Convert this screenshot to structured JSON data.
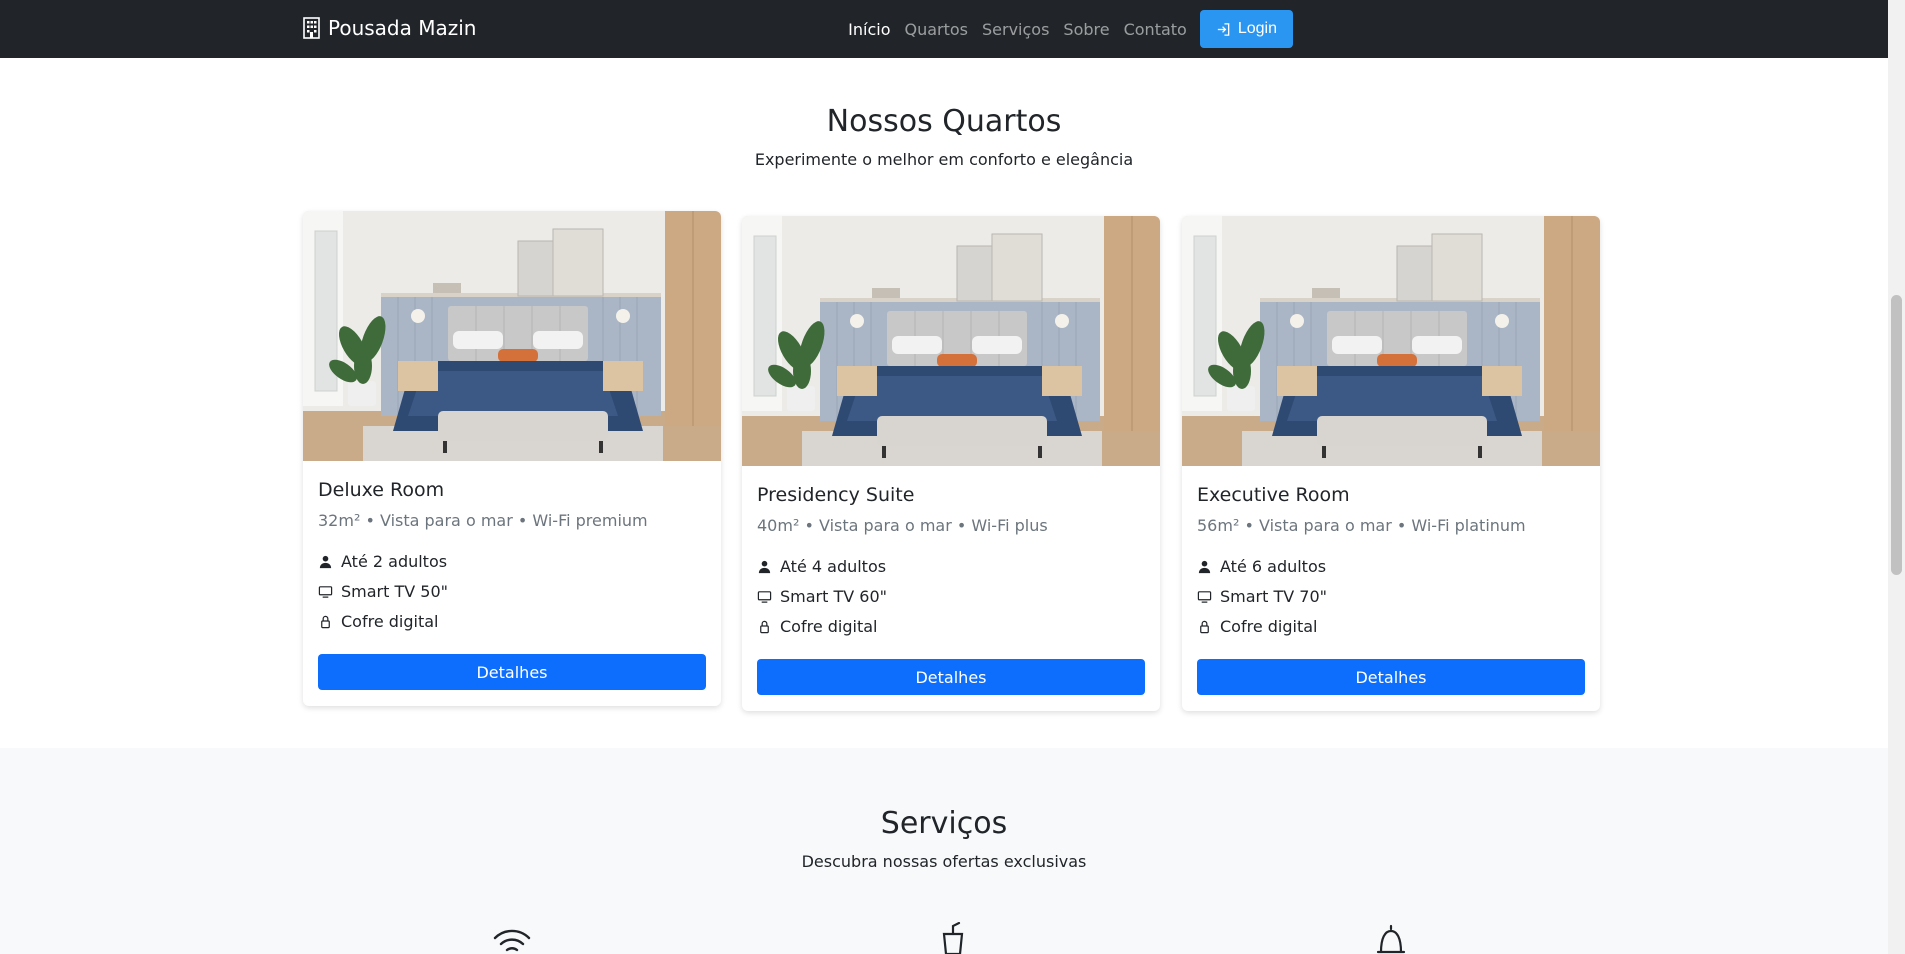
{
  "navbar": {
    "brand": "Pousada Mazin",
    "links": [
      "Início",
      "Quartos",
      "Serviços",
      "Sobre",
      "Contato"
    ],
    "login": "Login"
  },
  "rooms": {
    "title": "Nossos Quartos",
    "subtitle": "Experimente o melhor em conforto e elegância",
    "cards": [
      {
        "name": "Deluxe Room",
        "meta": "32m² • Vista para o mar • Wi-Fi premium",
        "guests": "Até 2 adultos",
        "tv": "Smart TV 50\"",
        "safe": "Cofre digital",
        "button": "Detalhes"
      },
      {
        "name": "Presidency Suite",
        "meta": "40m² • Vista para o mar • Wi-Fi plus",
        "guests": "Até 4 adultos",
        "tv": "Smart TV 60\"",
        "safe": "Cofre digital",
        "button": "Detalhes"
      },
      {
        "name": "Executive Room",
        "meta": "56m² • Vista para o mar • Wi-Fi platinum",
        "guests": "Até 6 adultos",
        "tv": "Smart TV 70\"",
        "safe": "Cofre digital",
        "button": "Detalhes"
      }
    ]
  },
  "services": {
    "title": "Serviços",
    "subtitle": "Descubra nossas ofertas exclusivas",
    "icons": [
      "wifi-icon",
      "drink-icon",
      "bell-icon"
    ]
  },
  "colors": {
    "navbar": "#212529",
    "login": "#2b96f2",
    "primary": "#0d6efd",
    "services_bg": "#f8f9fa"
  }
}
